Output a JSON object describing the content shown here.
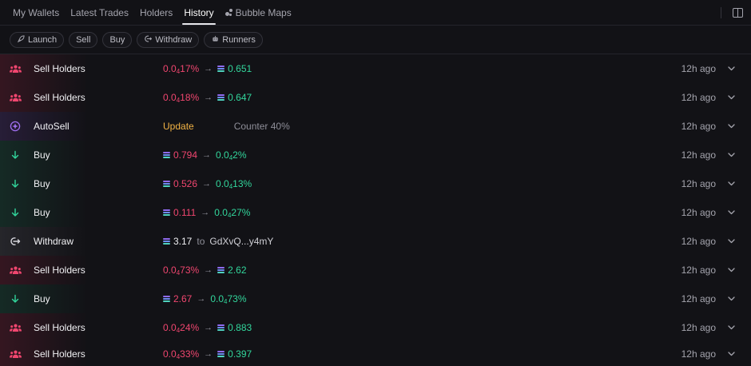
{
  "tabs": [
    {
      "label": "My Wallets",
      "active": false
    },
    {
      "label": "Latest Trades",
      "active": false
    },
    {
      "label": "Holders",
      "active": false
    },
    {
      "label": "History",
      "active": true
    },
    {
      "label": "Bubble Maps",
      "active": false
    }
  ],
  "filters": [
    {
      "label": "Launch",
      "icon": "rocket-icon"
    },
    {
      "label": "Sell",
      "icon": ""
    },
    {
      "label": "Buy",
      "icon": ""
    },
    {
      "label": "Withdraw",
      "icon": "withdraw-icon"
    },
    {
      "label": "Runners",
      "icon": "robot-icon"
    }
  ],
  "colors": {
    "red": "#f0466f",
    "green": "#32d69c",
    "gold": "#f2b345",
    "bg": "#121216"
  },
  "rows": [
    {
      "type": "sell",
      "label": "Sell Holders",
      "from": "0.0₄17%",
      "to": "0.651",
      "time": "12h ago"
    },
    {
      "type": "sell",
      "label": "Sell Holders",
      "from": "0.0₄18%",
      "to": "0.647",
      "time": "12h ago"
    },
    {
      "type": "auto",
      "label": "AutoSell",
      "status": "Update",
      "note": "Counter 40%",
      "time": "12h ago"
    },
    {
      "type": "buy",
      "label": "Buy",
      "from": "0.794",
      "to": "0.0₄2%",
      "time": "12h ago"
    },
    {
      "type": "buy",
      "label": "Buy",
      "from": "0.526",
      "to": "0.0₄13%",
      "time": "12h ago"
    },
    {
      "type": "buy",
      "label": "Buy",
      "from": "0.111",
      "to": "0.0₄27%",
      "time": "12h ago"
    },
    {
      "type": "withdraw",
      "label": "Withdraw",
      "amount": "3.17",
      "to_word": "to",
      "address": "GdXvQ...y4mY",
      "time": "12h ago"
    },
    {
      "type": "sell",
      "label": "Sell Holders",
      "from": "0.0₄73%",
      "to": "2.62",
      "time": "12h ago"
    },
    {
      "type": "buy",
      "label": "Buy",
      "from": "2.67",
      "to": "0.0₄73%",
      "time": "12h ago"
    },
    {
      "type": "sell",
      "label": "Sell Holders",
      "from": "0.0₄24%",
      "to": "0.883",
      "time": "12h ago"
    },
    {
      "type": "sell",
      "label": "Sell Holders",
      "from": "0.0₄33%",
      "to": "0.397",
      "time": "12h ago"
    }
  ]
}
